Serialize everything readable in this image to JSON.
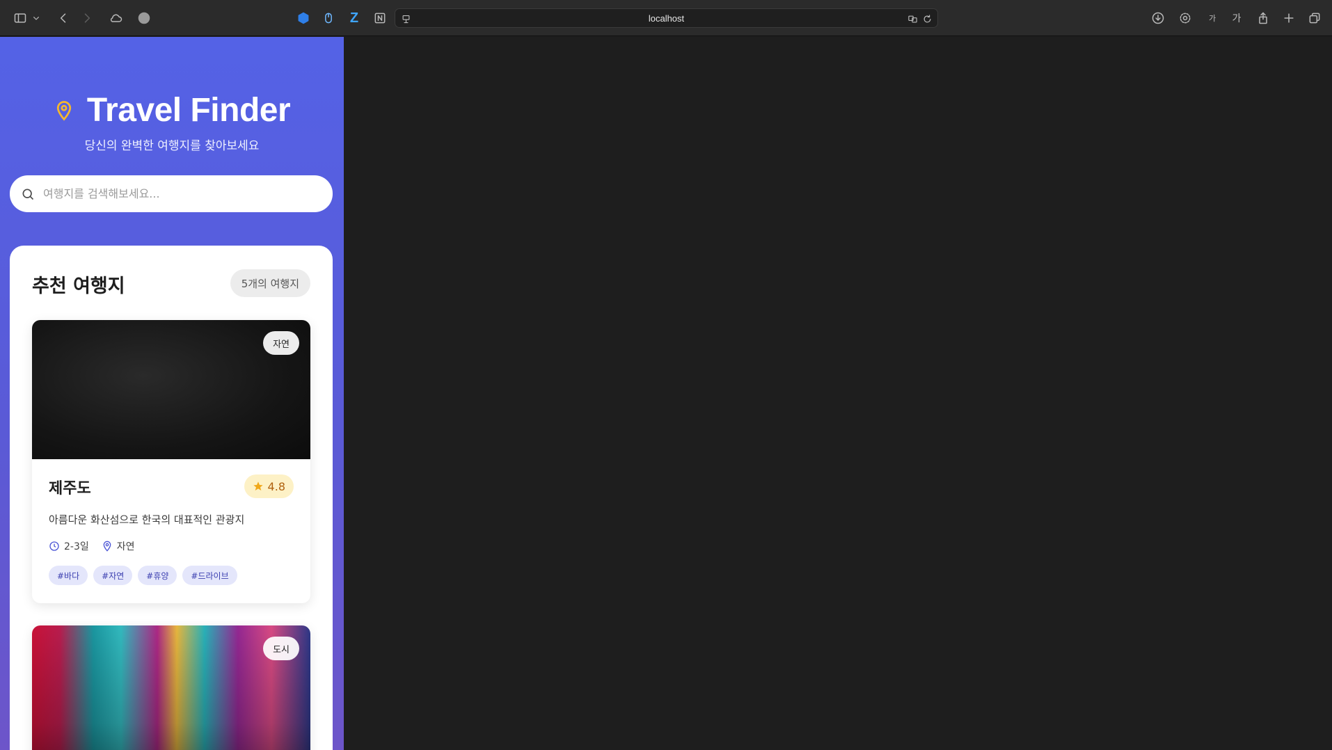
{
  "browser": {
    "url": "localhost"
  },
  "app": {
    "title": "Travel Finder",
    "subtitle": "당신의 완벽한 여행지를 찾아보세요",
    "search_placeholder": "여행지를 검색해보세요...",
    "section_title": "추천 여행지",
    "result_count": "5개의 여행지",
    "accent_color": "#5462e6",
    "pin_color": "#f5b82e"
  },
  "destinations": [
    {
      "name": "제주도",
      "category": "자연",
      "rating": "4.8",
      "description": "아름다운 화산섬으로 한국의 대표적인 관광지",
      "duration": "2-3일",
      "type": "자연",
      "tags": [
        "#바다",
        "#자연",
        "#휴양",
        "#드라이브"
      ]
    },
    {
      "category": "도시"
    }
  ]
}
